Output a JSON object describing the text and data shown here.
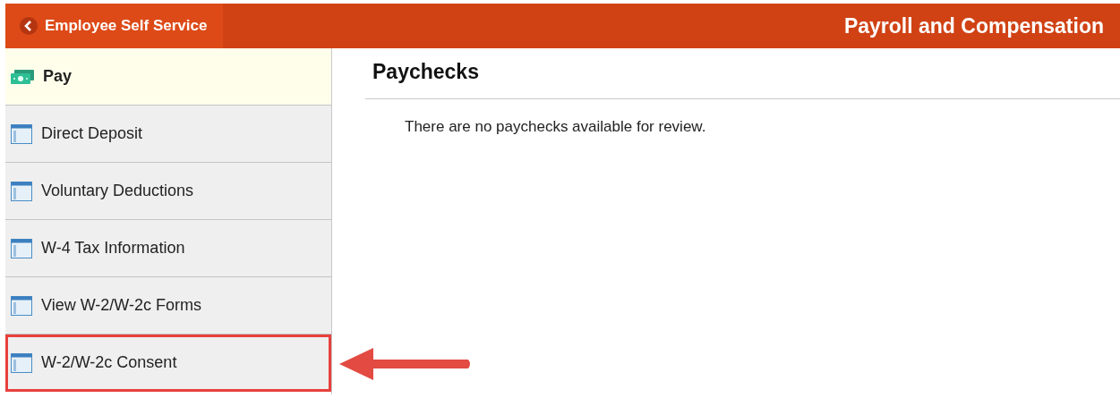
{
  "header": {
    "back_label": "Employee Self Service",
    "title": "Payroll and Compensation"
  },
  "sidebar": {
    "items": [
      {
        "label": "Pay",
        "kind": "money",
        "selected": true,
        "callout": false
      },
      {
        "label": "Direct Deposit",
        "kind": "page",
        "selected": false,
        "callout": false
      },
      {
        "label": "Voluntary Deductions",
        "kind": "page",
        "selected": false,
        "callout": false
      },
      {
        "label": "W-4 Tax Information",
        "kind": "page",
        "selected": false,
        "callout": false
      },
      {
        "label": "View W-2/W-2c Forms",
        "kind": "page",
        "selected": false,
        "callout": false
      },
      {
        "label": "W-2/W-2c Consent",
        "kind": "page",
        "selected": false,
        "callout": true
      }
    ]
  },
  "content": {
    "title": "Paychecks",
    "message": "There are no paychecks available for review."
  }
}
